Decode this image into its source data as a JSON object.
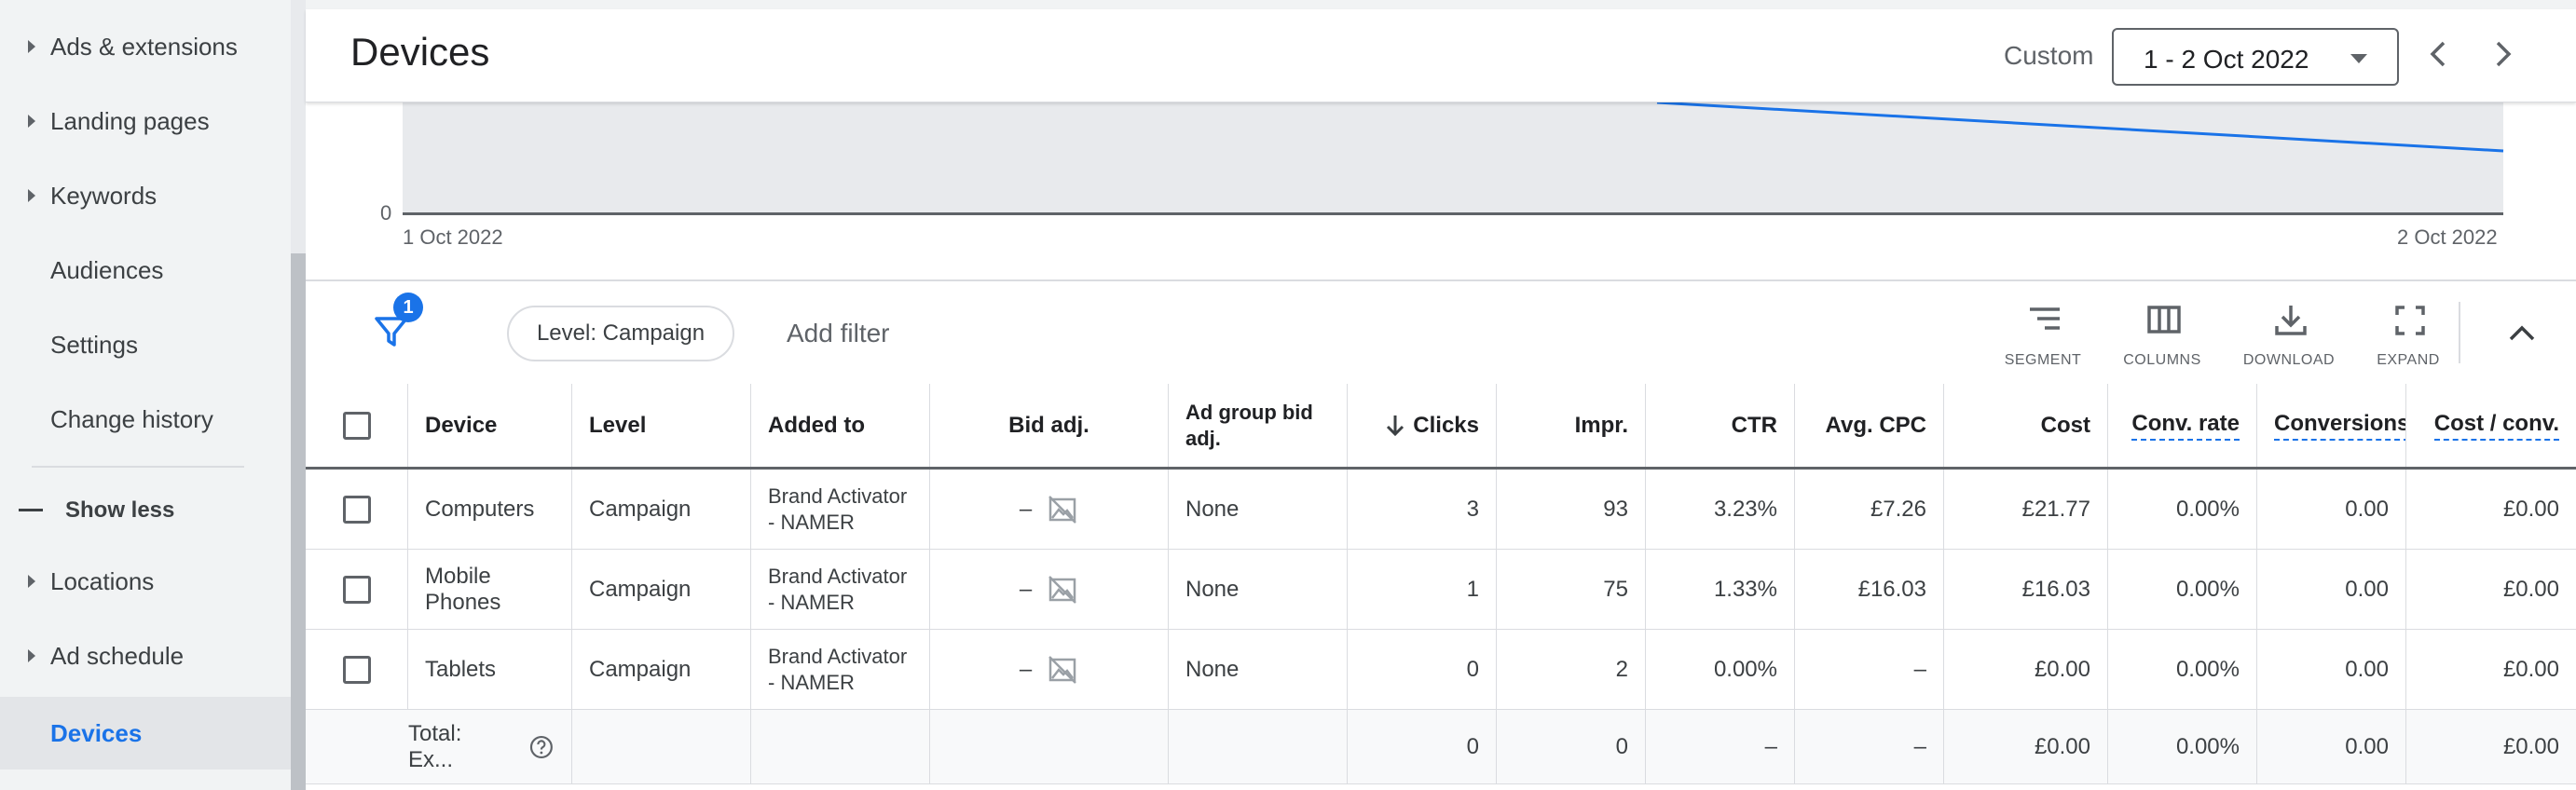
{
  "sidebar": {
    "items": [
      {
        "label": "Ads & extensions",
        "caret": true
      },
      {
        "label": "Landing pages",
        "caret": true
      },
      {
        "label": "Keywords",
        "caret": true
      },
      {
        "label": "Audiences",
        "caret": false
      },
      {
        "label": "Settings",
        "caret": false
      },
      {
        "label": "Change history",
        "caret": false
      }
    ],
    "show_less": "Show less",
    "items_after": [
      {
        "label": "Locations",
        "caret": true
      },
      {
        "label": "Ad schedule",
        "caret": true
      },
      {
        "label": "Devices",
        "caret": false,
        "active": true
      }
    ]
  },
  "header": {
    "title": "Devices",
    "custom_label": "Custom",
    "date_range": "1 - 2 Oct 2022"
  },
  "chart_data": {
    "type": "line",
    "x": [
      "1 Oct 2022",
      "2 Oct 2022"
    ],
    "y_tick_visible": "0",
    "x_labels": {
      "start": "1 Oct 2022",
      "end": "2 Oct 2022"
    },
    "grid": false
  },
  "filter": {
    "badge_count": "1",
    "level_chip": "Level: Campaign",
    "add_filter": "Add filter"
  },
  "toolbar": {
    "segment": "SEGMENT",
    "columns": "COLUMNS",
    "download": "DOWNLOAD",
    "expand": "EXPAND"
  },
  "table": {
    "headers": {
      "device": "Device",
      "level": "Level",
      "added_to": "Added to",
      "bid_adj": "Bid adj.",
      "ad_group_bid_adj": "Ad group bid adj.",
      "clicks": "Clicks",
      "impr": "Impr.",
      "ctr": "CTR",
      "avg_cpc": "Avg. CPC",
      "cost": "Cost",
      "conv_rate": "Conv. rate",
      "conversions": "Conversions",
      "cost_conv": "Cost / conv."
    },
    "rows": [
      {
        "device": "Computers",
        "level": "Campaign",
        "added_to": "Brand Activator - NAMER",
        "bid_adj": "–",
        "ad_group_bid_adj": "None",
        "clicks": "3",
        "impr": "93",
        "ctr": "3.23%",
        "avg_cpc": "£7.26",
        "cost": "£21.77",
        "conv_rate": "0.00%",
        "conversions": "0.00",
        "cost_conv": "£0.00"
      },
      {
        "device": "Mobile Phones",
        "level": "Campaign",
        "added_to": "Brand Activator - NAMER",
        "bid_adj": "–",
        "ad_group_bid_adj": "None",
        "clicks": "1",
        "impr": "75",
        "ctr": "1.33%",
        "avg_cpc": "£16.03",
        "cost": "£16.03",
        "conv_rate": "0.00%",
        "conversions": "0.00",
        "cost_conv": "£0.00"
      },
      {
        "device": "Tablets",
        "level": "Campaign",
        "added_to": "Brand Activator - NAMER",
        "bid_adj": "–",
        "ad_group_bid_adj": "None",
        "clicks": "0",
        "impr": "2",
        "ctr": "0.00%",
        "avg_cpc": "–",
        "cost": "£0.00",
        "conv_rate": "0.00%",
        "conversions": "0.00",
        "cost_conv": "£0.00"
      }
    ],
    "total": {
      "label": "Total: Ex...",
      "clicks": "0",
      "impr": "0",
      "ctr": "–",
      "avg_cpc": "–",
      "cost": "£0.00",
      "conv_rate": "0.00%",
      "conversions": "0.00",
      "cost_conv": "£0.00"
    }
  },
  "colors": {
    "accent": "#1a73e8",
    "text": "#3c4043",
    "muted": "#5f6368",
    "divider": "#dadce0"
  }
}
